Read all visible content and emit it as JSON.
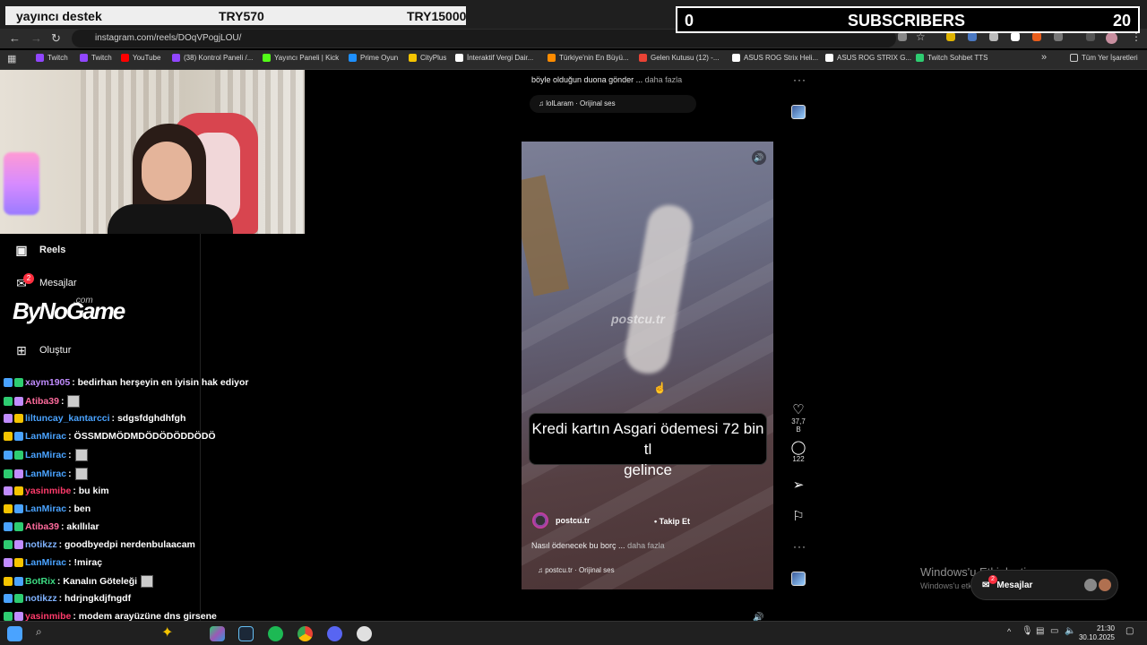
{
  "overlay": {
    "support_label": "yayıncı destek",
    "support_current": "TRY570",
    "support_goal": "TRY15000",
    "subs_current": "0",
    "subs_label": "SUBSCRIBERS",
    "subs_goal": "20"
  },
  "browser": {
    "url": "instagram.com/reels/DOqVPogjLOU/",
    "bookmarks": [
      {
        "label": "Twitch",
        "color": "#9146ff"
      },
      {
        "label": "Twitch",
        "color": "#9146ff"
      },
      {
        "label": "YouTube",
        "color": "#ff0000"
      },
      {
        "label": "(38) Kontrol Paneli /...",
        "color": "#9146ff"
      },
      {
        "label": "Yayıncı Paneli | Kick",
        "color": "#53fc18"
      },
      {
        "label": "Prime Oyun",
        "color": "#1e90ff"
      },
      {
        "label": "CityPlus",
        "color": "#f5c400"
      },
      {
        "label": "İnteraktif Vergi Dair...",
        "color": "#ffffff"
      },
      {
        "label": "Türkiye'nin En Büyü...",
        "color": "#ff8c00"
      },
      {
        "label": "Gelen Kutusu (12) -...",
        "color": "#ea4335"
      },
      {
        "label": "ASUS ROG Strix Heli...",
        "color": "#ffffff"
      },
      {
        "label": "ASUS ROG STRIX G...",
        "color": "#ffffff"
      },
      {
        "label": "Twitch Sohbet TTS",
        "color": "#2ecc71"
      }
    ],
    "all_bookmarks": "Tüm Yer İşaretleri"
  },
  "nav": {
    "reels": "Reels",
    "messages": "Mesajlar",
    "messages_badge": "2",
    "create": "Oluştur",
    "logo": "ByNoGame",
    "logo_sub": ".com"
  },
  "chat": [
    {
      "user": "xaym1905",
      "color": "#c18cff",
      "msg": ": bedirhan herşeyin en iyisin hak ediyor",
      "emote": false
    },
    {
      "user": "Atiba39",
      "color": "#ff6b9d",
      "msg": ":",
      "emote": true
    },
    {
      "user": "liltuncay_kantarcci",
      "color": "#4aa3ff",
      "msg": ": sdgsfdghdhfgh",
      "emote": false
    },
    {
      "user": "LanMirac",
      "color": "#4aa3ff",
      "msg": ": ÖSSMDMÖDMDÖDÖDÖDDÖDÖ",
      "emote": false
    },
    {
      "user": "LanMirac",
      "color": "#4aa3ff",
      "msg": ":",
      "emote": true
    },
    {
      "user": "LanMirac",
      "color": "#4aa3ff",
      "msg": ":",
      "emote": true
    },
    {
      "user": "yasinmibe",
      "color": "#ff3b6b",
      "msg": ": bu kim",
      "emote": false
    },
    {
      "user": "LanMirac",
      "color": "#4aa3ff",
      "msg": ": ben",
      "emote": false
    },
    {
      "user": "Atiba39",
      "color": "#ff6b9d",
      "msg": ": akıllılar",
      "emote": false
    },
    {
      "user": "notikzz",
      "color": "#7fb2ff",
      "msg": ": goodbyedpi nerdenbulaacam",
      "emote": false
    },
    {
      "user": "LanMirac",
      "color": "#4aa3ff",
      "msg": ": !miraç",
      "emote": false
    },
    {
      "user": "BotRix",
      "color": "#3ddc84",
      "msg": ": Kanalın Göteleği",
      "emote": true
    },
    {
      "user": "notikzz",
      "color": "#7fb2ff",
      "msg": ": hdrjngkdjfngdf",
      "emote": false
    },
    {
      "user": "yasinmibe",
      "color": "#ff3b6b",
      "msg": ": modem arayüzüne dns girsene",
      "emote": false
    }
  ],
  "reel_prev": {
    "caption": "böyle olduğun duona gönder ...",
    "more": "daha fazla",
    "audio": "lolLaram · Orijinal ses"
  },
  "reel": {
    "watermark": "postcu.tr",
    "caption_line1": "Kredi kartın Asgari ödemesi 72 bin tl",
    "caption_line2": "gelince",
    "author": "postcu.tr",
    "follow": "Takip Et",
    "description": "Nasıl ödenecek bu borç ...",
    "more": "daha fazla",
    "audio": "postcu.tr · Orijinal ses",
    "likes": "37,7 B",
    "comments": "122"
  },
  "windows": {
    "activate_title": "Windows'u Etkinleştir",
    "activate_sub": "Windows'u etkinleştirmek için Ayarlar'a gidin",
    "messages_pill": "Mesajlar",
    "messages_badge": "2",
    "time": "21:30",
    "date": "30.10.2025"
  }
}
